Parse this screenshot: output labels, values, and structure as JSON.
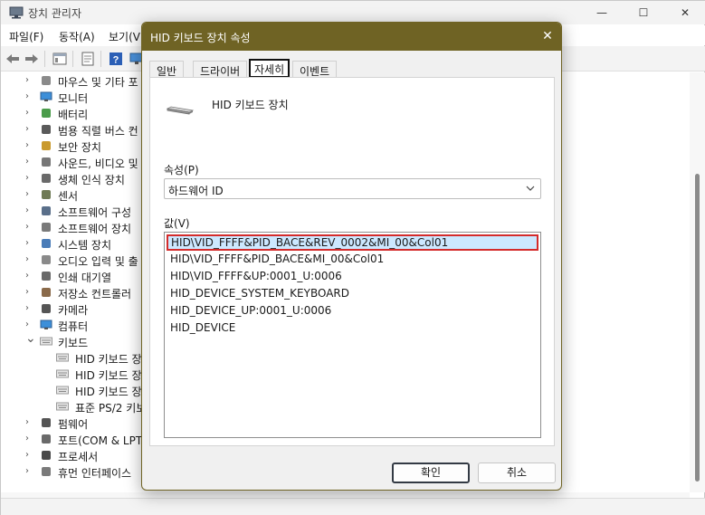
{
  "window": {
    "title": "장치 관리자",
    "menu": [
      "파일(F)",
      "동작(A)",
      "보기(V"
    ],
    "caption": {
      "minimize": "—",
      "maximize": "☐",
      "close": "✕"
    }
  },
  "tree": {
    "items": [
      {
        "label": "마우스 및 기타 포",
        "icon": "mouse-icon",
        "expanded": false
      },
      {
        "label": "모니터",
        "icon": "monitor-icon",
        "expanded": false
      },
      {
        "label": "배터리",
        "icon": "battery-icon",
        "expanded": false
      },
      {
        "label": "범용 직렬 버스 컨",
        "icon": "usb-controller-icon",
        "expanded": false
      },
      {
        "label": "보안 장치",
        "icon": "security-device-icon",
        "expanded": false
      },
      {
        "label": "사운드, 비디오 및",
        "icon": "speaker-icon",
        "expanded": false
      },
      {
        "label": "생체 인식 장치",
        "icon": "fingerprint-icon",
        "expanded": false
      },
      {
        "label": "센서",
        "icon": "sensor-icon",
        "expanded": false
      },
      {
        "label": "소프트웨어 구성",
        "icon": "software-component-icon",
        "expanded": false
      },
      {
        "label": "소프트웨어 장치",
        "icon": "software-device-icon",
        "expanded": false
      },
      {
        "label": "시스템 장치",
        "icon": "system-device-icon",
        "expanded": false
      },
      {
        "label": "오디오 입력 및 출",
        "icon": "audio-io-icon",
        "expanded": false
      },
      {
        "label": "인쇄 대기열",
        "icon": "printer-icon",
        "expanded": false
      },
      {
        "label": "저장소 컨트롤러",
        "icon": "storage-controller-icon",
        "expanded": false
      },
      {
        "label": "카메라",
        "icon": "camera-icon",
        "expanded": false
      },
      {
        "label": "컴퓨터",
        "icon": "computer-icon",
        "expanded": false
      },
      {
        "label": "키보드",
        "icon": "keyboard-icon",
        "expanded": true
      },
      {
        "label": "HID 키보드 장",
        "icon": "keyboard-icon",
        "child": true
      },
      {
        "label": "HID 키보드 장",
        "icon": "keyboard-icon",
        "child": true
      },
      {
        "label": "HID 키보드 장",
        "icon": "keyboard-icon",
        "child": true
      },
      {
        "label": "표준 PS/2 키보",
        "icon": "keyboard-icon",
        "child": true
      },
      {
        "label": "펌웨어",
        "icon": "firmware-icon",
        "expanded": false
      },
      {
        "label": "포트(COM & LPT",
        "icon": "port-icon",
        "expanded": false
      },
      {
        "label": "프로세서",
        "icon": "processor-icon",
        "expanded": false
      },
      {
        "label": "휴먼 인터페이스",
        "icon": "hid-icon",
        "expanded": false
      }
    ]
  },
  "dialog": {
    "title": "HID 키보드 장치 속성",
    "close": "✕",
    "tabs": [
      {
        "label": "일반",
        "active": false
      },
      {
        "label": "드라이버",
        "active": false
      },
      {
        "label": "자세히",
        "active": true
      },
      {
        "label": "이벤트",
        "active": false
      }
    ],
    "device_name": "HID 키보드 장치",
    "property_label": "속성(P)",
    "property_value": "하드웨어 ID",
    "value_label": "값(V)",
    "values": [
      "HID\\VID_FFFF&PID_BACE&REV_0002&MI_00&Col01",
      "HID\\VID_FFFF&PID_BACE&MI_00&Col01",
      "HID\\VID_FFFF&UP:0001_U:0006",
      "HID_DEVICE_SYSTEM_KEYBOARD",
      "HID_DEVICE_UP:0001_U:0006",
      "HID_DEVICE"
    ],
    "selected_value_index": 0,
    "ok_label": "확인",
    "cancel_label": "취소"
  },
  "colors": {
    "dialog_titlebar": "#6f6324",
    "selection_bg": "#cce8ff",
    "selection_outline": "#d42b2b"
  }
}
